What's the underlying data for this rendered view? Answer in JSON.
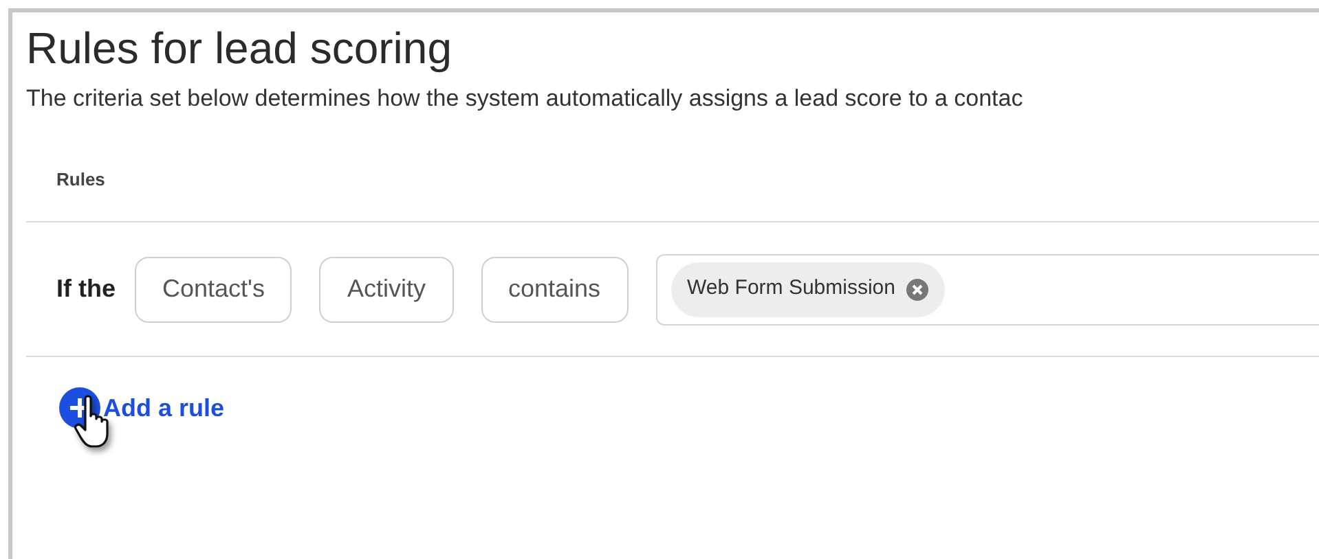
{
  "title": "Rules for lead scoring",
  "description": "The criteria set below determines how the system automatically assigns a lead score to a contac",
  "rules_header": "Rules",
  "rule": {
    "prefix": "If the",
    "selectors": [
      "Contact's",
      "Activity",
      "contains"
    ],
    "tags": [
      {
        "label": "Web Form Submission"
      }
    ]
  },
  "add_rule": {
    "label": "Add a rule"
  }
}
